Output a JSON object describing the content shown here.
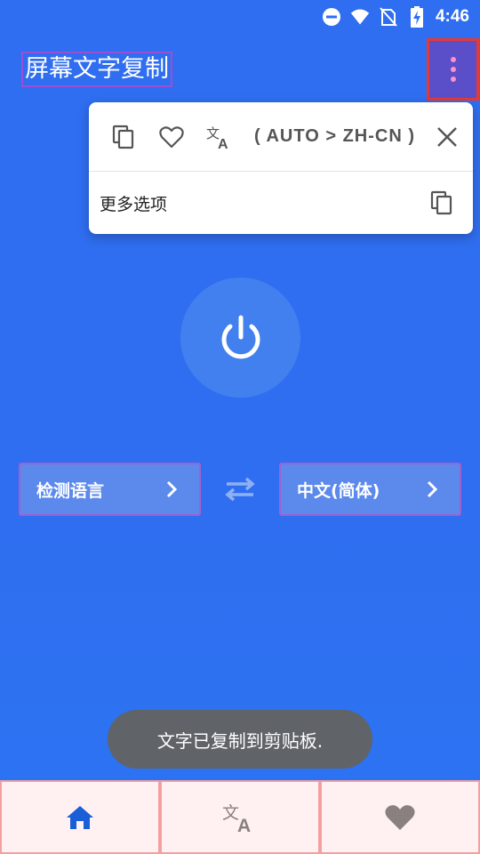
{
  "status_bar": {
    "time": "4:46",
    "icons": [
      "do-not-disturb-icon",
      "wifi-icon",
      "no-sim-icon",
      "battery-charging-icon"
    ]
  },
  "app_bar": {
    "title": "屏幕文字复制",
    "overflow_icon": "more-vert-icon"
  },
  "popup": {
    "icons": [
      "copy-icon",
      "heart-icon",
      "translate-icon"
    ],
    "language_pair": "( AUTO > ZH-CN )",
    "close_icon": "close-icon",
    "more_options_label": "更多选项",
    "more_options_icon": "copy-icon"
  },
  "main": {
    "power_icon": "power-icon",
    "source_language": "检测语言",
    "target_language": "中文(简体)",
    "swap_icon": "swap-horizontal-icon"
  },
  "toast": {
    "message": "文字已复制到剪贴板."
  },
  "bottom_nav": {
    "items": [
      {
        "icon": "home-icon",
        "active": true
      },
      {
        "icon": "translate-icon",
        "active": false
      },
      {
        "icon": "heart-icon",
        "active": false
      }
    ]
  },
  "colors": {
    "background": "#2f6ef0",
    "power_button": "#4180ee",
    "language_button": "#5b89ec",
    "overflow_highlight": "#5b4fc9",
    "toast_bg": "#606368",
    "nav_bg": "#fff1f1",
    "nav_active_icon": "#1a5fd8",
    "nav_inactive_icon": "#8a8080"
  }
}
